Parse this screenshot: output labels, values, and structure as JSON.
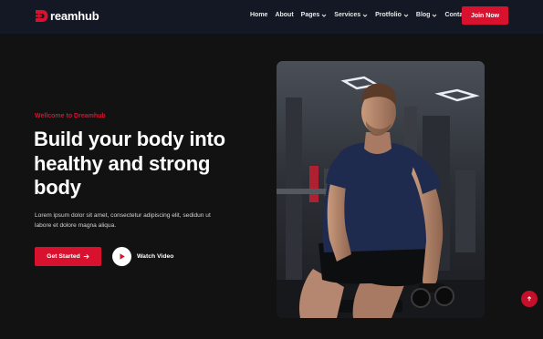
{
  "brand": {
    "name": "Dreamhub",
    "wordmark": "reamhub",
    "accent": "#d8112f"
  },
  "nav": {
    "items": [
      {
        "label": "Home",
        "dropdown": false
      },
      {
        "label": "About",
        "dropdown": false
      },
      {
        "label": "Pages",
        "dropdown": true
      },
      {
        "label": "Services",
        "dropdown": true
      },
      {
        "label": "Protfolio",
        "dropdown": true
      },
      {
        "label": "Blog",
        "dropdown": true
      },
      {
        "label": "Contact",
        "dropdown": false
      }
    ],
    "cta_label": "Join Now"
  },
  "hero": {
    "eyebrow": "Wellcome to Dreamhub",
    "headline_lines": [
      "Build your body into",
      "healthy and strong",
      "body"
    ],
    "body_lines": [
      "Lorem ipsum dolor sit amet, consectetur adipiscing elit, sedidun ut",
      "labore et dolore magna aliqua."
    ],
    "primary_button": {
      "label": "Get Started",
      "icon": "arrow-right-icon"
    },
    "video_button": {
      "label": "Watch Video",
      "icon": "play-icon"
    },
    "image": {
      "subject": "man in navy t-shirt seated in a gym holding a dumbbell"
    }
  },
  "scroll_top": {
    "icon": "arrow-up-icon"
  }
}
